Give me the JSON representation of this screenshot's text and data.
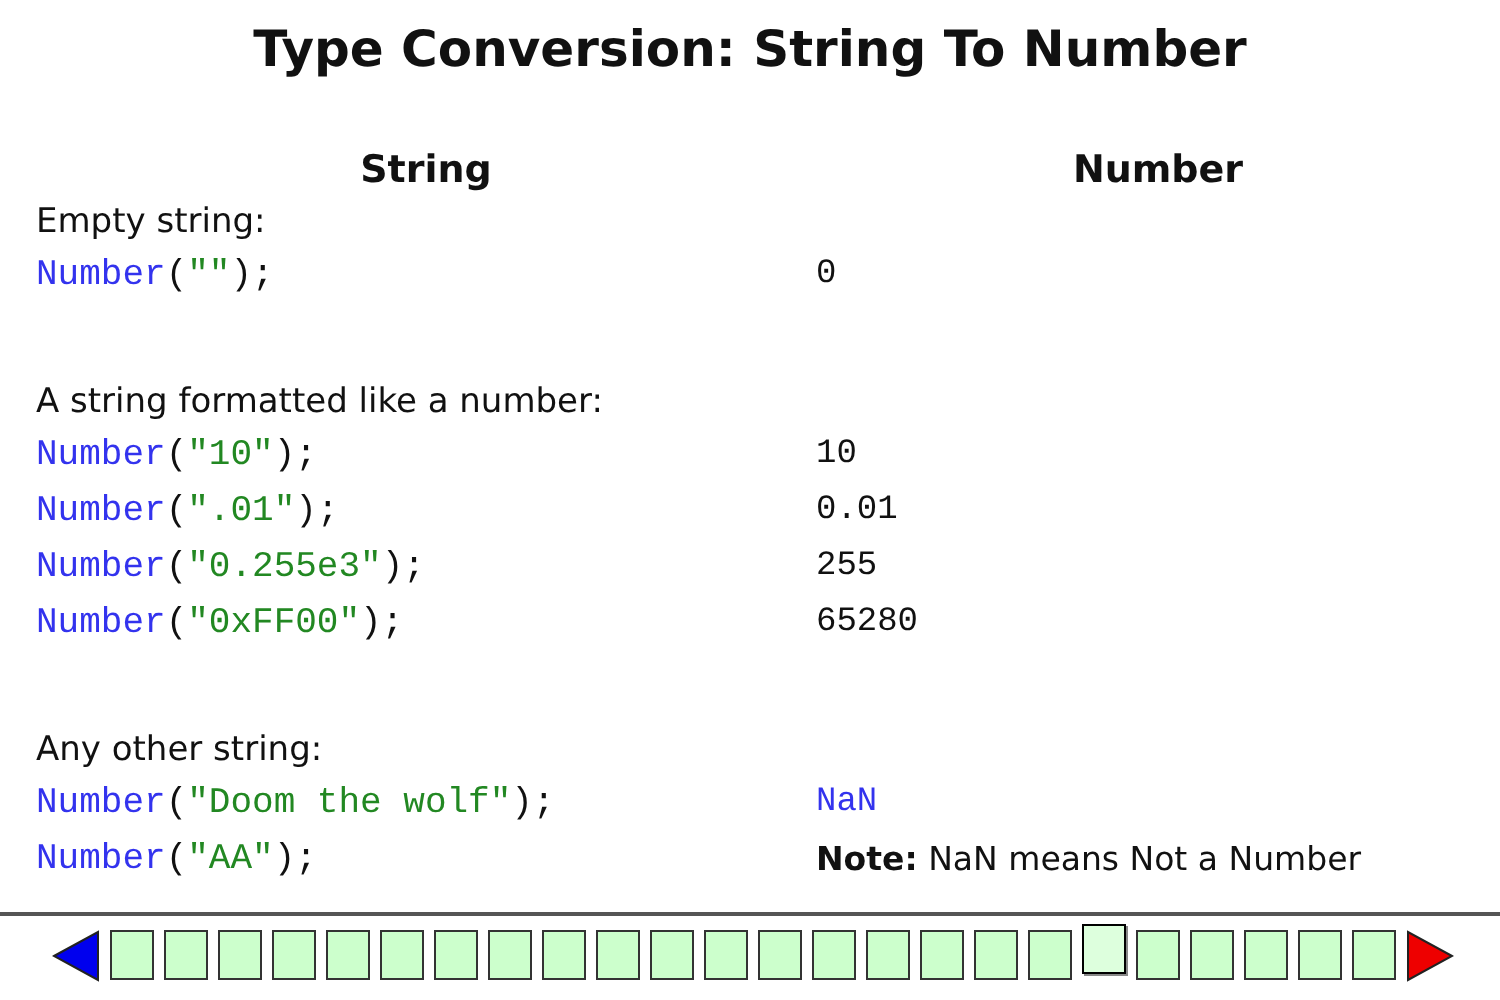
{
  "title": "Type Conversion: String To Number",
  "columns": [
    "String",
    "Number"
  ],
  "groups": [
    {
      "label": "Empty string:",
      "rows": [
        {
          "code": [
            {
              "kind": "func",
              "text": "Number"
            },
            {
              "kind": "punct",
              "text": "("
            },
            {
              "kind": "string",
              "text": "\"\""
            },
            {
              "kind": "punct",
              "text": ");"
            }
          ],
          "result": {
            "kind": "value",
            "text": "0"
          }
        }
      ]
    },
    {
      "label": "A string formatted like a number:",
      "rows": [
        {
          "code": [
            {
              "kind": "func",
              "text": "Number"
            },
            {
              "kind": "punct",
              "text": "("
            },
            {
              "kind": "string",
              "text": "\"10\""
            },
            {
              "kind": "punct",
              "text": ");"
            }
          ],
          "result": {
            "kind": "value",
            "text": "10"
          }
        },
        {
          "code": [
            {
              "kind": "func",
              "text": "Number"
            },
            {
              "kind": "punct",
              "text": "("
            },
            {
              "kind": "string",
              "text": "\".01\""
            },
            {
              "kind": "punct",
              "text": ");"
            }
          ],
          "result": {
            "kind": "value",
            "text": "0.01"
          }
        },
        {
          "code": [
            {
              "kind": "func",
              "text": "Number"
            },
            {
              "kind": "punct",
              "text": "("
            },
            {
              "kind": "string",
              "text": "\"0.255e3\""
            },
            {
              "kind": "punct",
              "text": ");"
            }
          ],
          "result": {
            "kind": "value",
            "text": "255"
          }
        },
        {
          "code": [
            {
              "kind": "func",
              "text": "Number"
            },
            {
              "kind": "punct",
              "text": "("
            },
            {
              "kind": "string",
              "text": "\"0xFF00\""
            },
            {
              "kind": "punct",
              "text": ");"
            }
          ],
          "result": {
            "kind": "value",
            "text": "65280"
          }
        }
      ]
    },
    {
      "label": "Any other string:",
      "rows": [
        {
          "code": [
            {
              "kind": "func",
              "text": "Number"
            },
            {
              "kind": "punct",
              "text": "("
            },
            {
              "kind": "string",
              "text": "\"Doom the wolf\""
            },
            {
              "kind": "punct",
              "text": ");"
            }
          ],
          "result": {
            "kind": "nan",
            "text": "NaN"
          }
        },
        {
          "code": [
            {
              "kind": "func",
              "text": "Number"
            },
            {
              "kind": "punct",
              "text": "("
            },
            {
              "kind": "string",
              "text": "\"AA\""
            },
            {
              "kind": "punct",
              "text": ");"
            }
          ],
          "result": {
            "kind": "note",
            "text": "**Note:** NaN means Not a Number"
          }
        }
      ]
    }
  ],
  "pages": [
    {
      "selected": false
    },
    {
      "selected": false
    },
    {
      "selected": false
    },
    {
      "selected": false
    },
    {
      "selected": false
    },
    {
      "selected": false
    },
    {
      "selected": false
    },
    {
      "selected": false
    },
    {
      "selected": false
    },
    {
      "selected": false
    },
    {
      "selected": false
    },
    {
      "selected": false
    },
    {
      "selected": false
    },
    {
      "selected": false
    },
    {
      "selected": false
    },
    {
      "selected": false
    },
    {
      "selected": false
    },
    {
      "selected": false
    },
    {
      "selected": true
    },
    {
      "selected": false
    },
    {
      "selected": false
    },
    {
      "selected": false
    },
    {
      "selected": false
    },
    {
      "selected": false
    }
  ]
}
